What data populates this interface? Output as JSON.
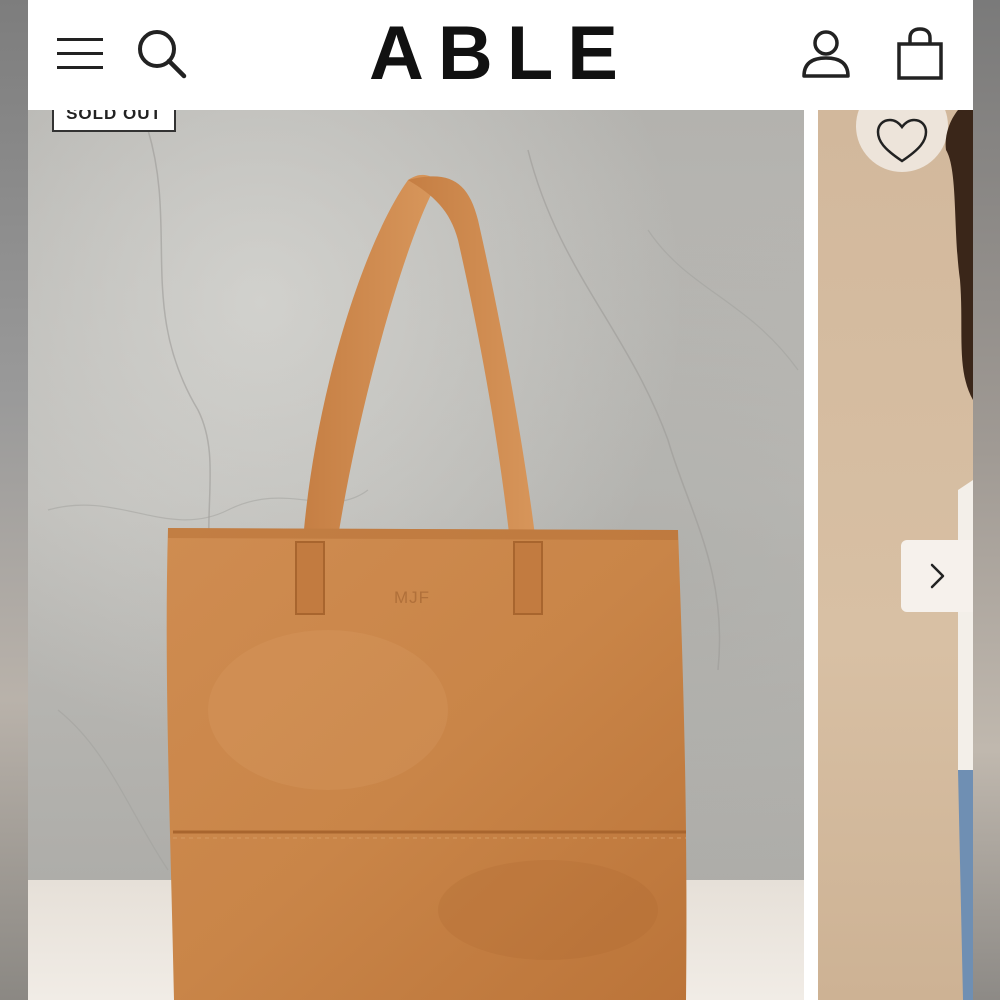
{
  "header": {
    "brand": "ABLE",
    "icons": {
      "menu": "hamburger-menu-icon",
      "search": "search-icon",
      "account": "account-icon",
      "cart": "shopping-bag-icon"
    }
  },
  "product": {
    "badge": "SOLD OUT",
    "embossed_initials": "MJF",
    "leather_color": "#c8854a"
  },
  "carousel": {
    "next_icon": "chevron-right-icon",
    "favorite_icon": "heart-icon"
  }
}
